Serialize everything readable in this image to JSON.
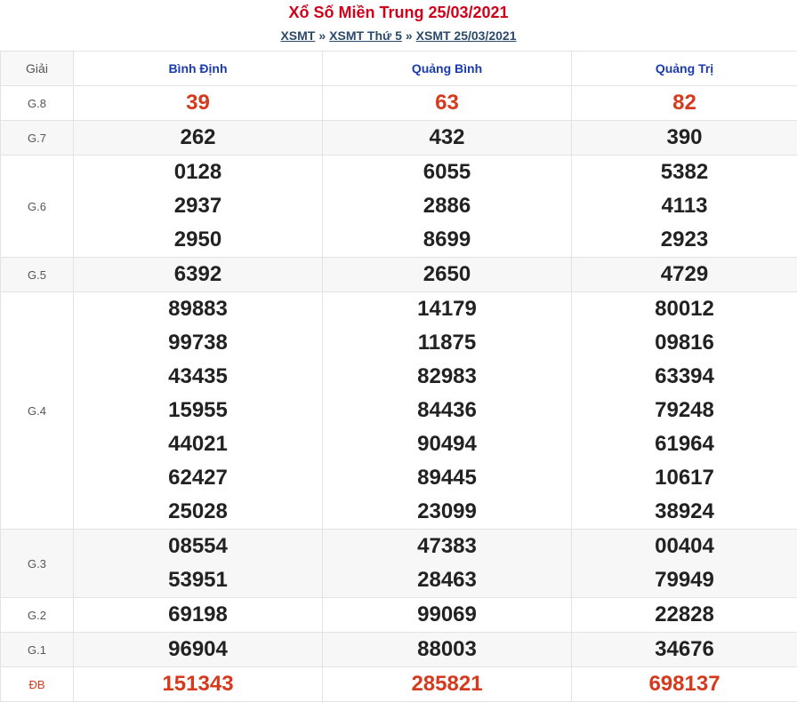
{
  "header": {
    "title": "Xổ Số Miền Trung 25/03/2021",
    "crumb1": "XSMT",
    "sep": "»",
    "crumb2": "XSMT Thứ 5",
    "crumb3": "XSMT 25/03/2021"
  },
  "table": {
    "giai_header": "Giải",
    "provinces": [
      "Bình Định",
      "Quảng Bình",
      "Quảng Trị"
    ],
    "rows": [
      {
        "label": "G.8",
        "red": true,
        "values": [
          [
            "39"
          ],
          [
            "63"
          ],
          [
            "82"
          ]
        ]
      },
      {
        "label": "G.7",
        "values": [
          [
            "262"
          ],
          [
            "432"
          ],
          [
            "390"
          ]
        ]
      },
      {
        "label": "G.6",
        "values": [
          [
            "0128",
            "2937",
            "2950"
          ],
          [
            "6055",
            "2886",
            "8699"
          ],
          [
            "5382",
            "4113",
            "2923"
          ]
        ]
      },
      {
        "label": "G.5",
        "values": [
          [
            "6392"
          ],
          [
            "2650"
          ],
          [
            "4729"
          ]
        ]
      },
      {
        "label": "G.4",
        "values": [
          [
            "89883",
            "99738",
            "43435",
            "15955",
            "44021",
            "62427",
            "25028"
          ],
          [
            "14179",
            "11875",
            "82983",
            "84436",
            "90494",
            "89445",
            "23099"
          ],
          [
            "80012",
            "09816",
            "63394",
            "79248",
            "61964",
            "10617",
            "38924"
          ]
        ]
      },
      {
        "label": "G.3",
        "values": [
          [
            "08554",
            "53951"
          ],
          [
            "47383",
            "28463"
          ],
          [
            "00404",
            "79949"
          ]
        ]
      },
      {
        "label": "G.2",
        "values": [
          [
            "69198"
          ],
          [
            "99069"
          ],
          [
            "22828"
          ]
        ]
      },
      {
        "label": "G.1",
        "values": [
          [
            "96904"
          ],
          [
            "88003"
          ],
          [
            "34676"
          ]
        ]
      },
      {
        "label": "ĐB",
        "red": true,
        "labelRed": true,
        "values": [
          [
            "151343"
          ],
          [
            "285821"
          ],
          [
            "698137"
          ]
        ]
      }
    ]
  }
}
